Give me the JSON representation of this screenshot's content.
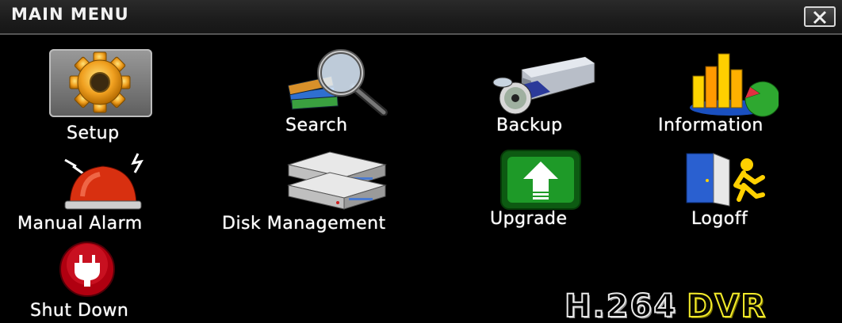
{
  "window": {
    "title": "MAIN MENU"
  },
  "menu": {
    "setup": "Setup",
    "search": "Search",
    "backup": "Backup",
    "information": "Information",
    "manual_alarm": "Manual Alarm",
    "disk_management": "Disk Management",
    "upgrade": "Upgrade",
    "logoff": "Logoff",
    "shut_down": "Shut Down"
  },
  "selected": "Setup",
  "brand": {
    "codec": "H.264",
    "product": "DVR"
  },
  "icons": {
    "setup": "gear-icon",
    "search": "magnifier-books-icon",
    "backup": "disc-drive-icon",
    "information": "bar-chart-icon",
    "manual_alarm": "alarm-siren-icon",
    "disk_management": "hard-disk-icon",
    "upgrade": "upgrade-arrow-icon",
    "logoff": "logoff-door-icon",
    "shut_down": "power-plug-icon"
  },
  "colors": {
    "background": "#000000",
    "selection": "#7a7a7a",
    "brand_dvr": "#f2ea2a"
  }
}
